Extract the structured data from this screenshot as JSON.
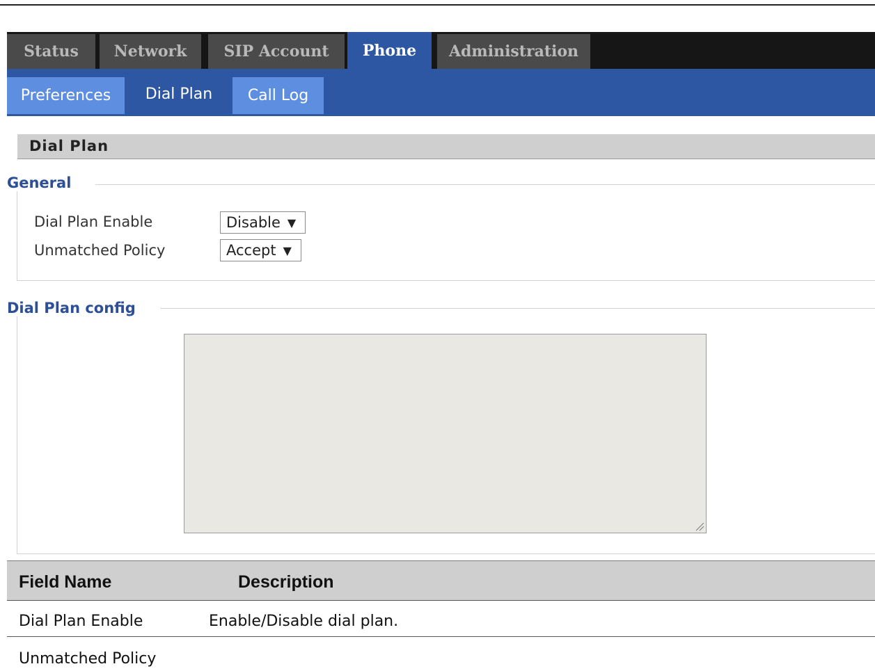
{
  "main_tabs": [
    {
      "label": "Status",
      "active": false
    },
    {
      "label": "Network",
      "active": false
    },
    {
      "label": "SIP Account",
      "active": false
    },
    {
      "label": "Phone",
      "active": true
    },
    {
      "label": "Administration",
      "active": false
    }
  ],
  "sub_tabs": [
    {
      "label": "Preferences",
      "active": false
    },
    {
      "label": "Dial Plan",
      "active": true
    },
    {
      "label": "Call Log",
      "active": false
    }
  ],
  "section_title": "Dial Plan",
  "general": {
    "legend": "General",
    "fields": [
      {
        "label": "Dial Plan Enable",
        "value": "Disable"
      },
      {
        "label": "Unmatched Policy",
        "value": "Accept"
      }
    ]
  },
  "dial_plan_config": {
    "legend": "Dial Plan config",
    "textarea_value": ""
  },
  "description_table": {
    "headers": [
      "Field Name",
      "Description"
    ],
    "rows": [
      [
        "Dial Plan Enable",
        "Enable/Disable dial plan."
      ],
      [
        "Unmatched Policy",
        ""
      ]
    ]
  },
  "colors": {
    "tab_active": "#2d56a3",
    "tab_inactive": "#4a4a4a",
    "subtab_inactive": "#5d8ee0",
    "legend_text": "#2d4f96"
  }
}
